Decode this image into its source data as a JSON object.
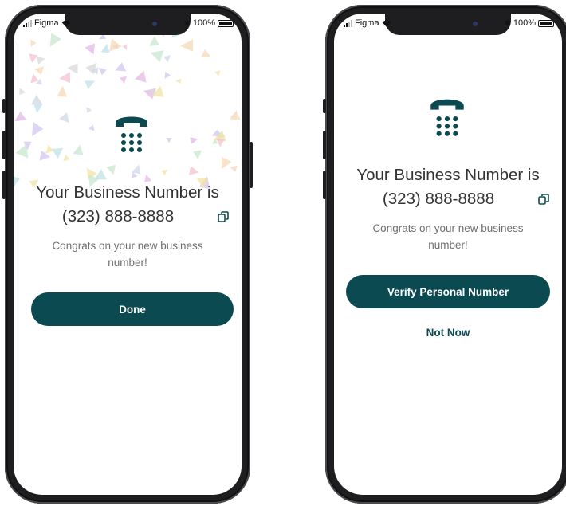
{
  "status_bar": {
    "carrier": "Figma",
    "battery": "100%"
  },
  "screen1": {
    "title_line1": "Your Business Number is",
    "phone_number": "(323) 888-8888",
    "subtitle": "Congrats on your new business number!",
    "done_button": "Done"
  },
  "screen2": {
    "title_line1": "Your Business Number is",
    "phone_number": "(323) 888-8888",
    "subtitle": "Congrats on your new business number!",
    "verify_button": "Verify Personal Number",
    "not_now_link": "Not Now"
  },
  "colors": {
    "accent": "#0c4a52",
    "title": "#333333",
    "subtitle": "#6f6f6f"
  },
  "icons": [
    "telephone-icon",
    "copy-icon",
    "signal-icon",
    "wifi-icon",
    "bluetooth-icon",
    "battery-icon"
  ]
}
